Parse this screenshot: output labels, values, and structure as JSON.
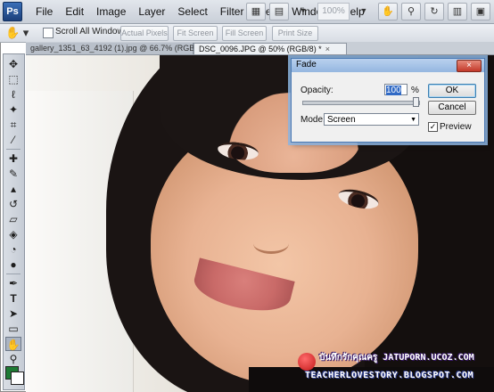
{
  "app": {
    "logo": "Ps"
  },
  "menu": [
    "File",
    "Edit",
    "Image",
    "Layer",
    "Select",
    "Filter",
    "View",
    "Window",
    "Help"
  ],
  "menubar_right": {
    "zoom": "100%"
  },
  "options": {
    "scroll_all_windows": "Scroll All Windows",
    "actual_pixels": "Actual Pixels",
    "fit_screen": "Fit Screen",
    "fill_screen": "Fill Screen",
    "print_size": "Print Size"
  },
  "doc_tabs": [
    {
      "label": "gallery_1351_63_4192 (1).jpg @ 66.7% (RGB/8#)",
      "close": "×"
    },
    {
      "label": "DSC_0096.JPG @ 50% (RGB/8) *",
      "close": "×"
    }
  ],
  "tools": [
    {
      "icon": "move-icon",
      "glyph": "✥"
    },
    {
      "icon": "marquee-icon",
      "glyph": "⬚"
    },
    {
      "icon": "lasso-icon",
      "glyph": "ℓ"
    },
    {
      "icon": "magic-wand-icon",
      "glyph": "✦"
    },
    {
      "icon": "crop-icon",
      "glyph": "⌗"
    },
    {
      "icon": "eyedropper-icon",
      "glyph": "⁄"
    },
    {
      "icon": "healing-brush-icon",
      "glyph": "✚"
    },
    {
      "icon": "brush-icon",
      "glyph": "✎"
    },
    {
      "icon": "clone-stamp-icon",
      "glyph": "▴"
    },
    {
      "icon": "history-brush-icon",
      "glyph": "↺"
    },
    {
      "icon": "eraser-icon",
      "glyph": "▱"
    },
    {
      "icon": "paint-bucket-icon",
      "glyph": "◈"
    },
    {
      "icon": "blur-icon",
      "glyph": "◔"
    },
    {
      "icon": "dodge-icon",
      "glyph": "●"
    },
    {
      "icon": "pen-icon",
      "glyph": "✒"
    },
    {
      "icon": "type-icon",
      "glyph": "T"
    },
    {
      "icon": "path-selection-icon",
      "glyph": "➤"
    },
    {
      "icon": "shape-icon",
      "glyph": "▭"
    },
    {
      "icon": "hand-icon",
      "glyph": "✋"
    },
    {
      "icon": "zoom-icon",
      "glyph": "⚲"
    }
  ],
  "colors": {
    "foreground": "#1e7a34",
    "background": "#ffffff",
    "dialog_border": "#4a79b3"
  },
  "fade_dialog": {
    "title": "Fade",
    "close": "×",
    "opacity_label": "Opacity:",
    "opacity_value": "100",
    "opacity_unit": "%",
    "mode_label": "Mode:",
    "mode_value": "Screen",
    "ok": "OK",
    "cancel": "Cancel",
    "preview_label": "Preview",
    "preview_checked": true,
    "slider_level": 1.0
  },
  "watermark": {
    "line1": "บันทึกรักคุณครู JATUPORN.UCOZ.COM",
    "line2": "TEACHERLOVESTORY.BLOGSPOT.COM"
  }
}
